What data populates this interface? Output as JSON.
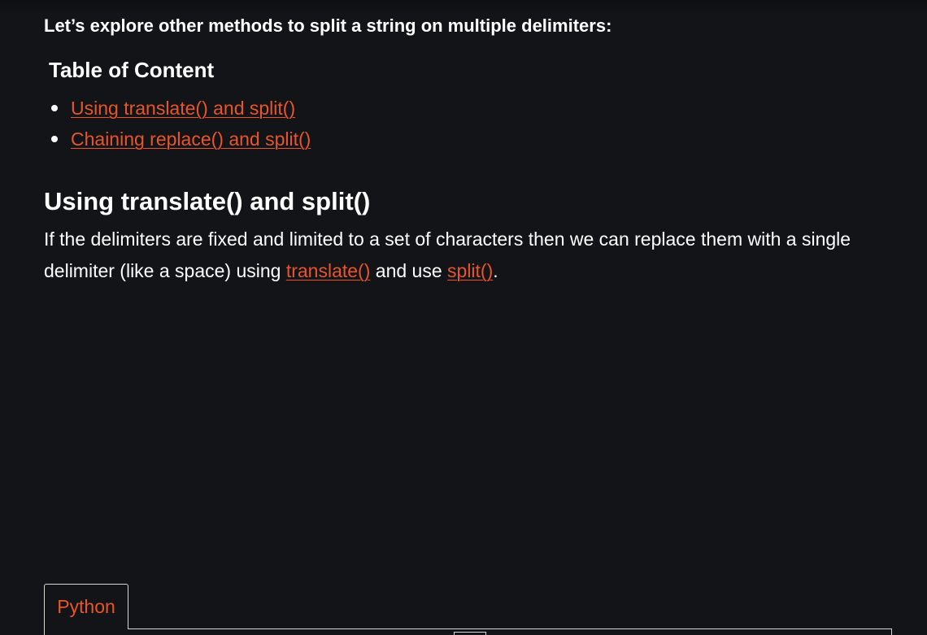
{
  "intro": "Let’s explore other methods to split a string on multiple delimiters:",
  "toc": {
    "title": "Table of Content",
    "items": [
      {
        "label": "Using translate() and split()"
      },
      {
        "label": "Chaining replace() and split()"
      }
    ]
  },
  "section": {
    "heading": "Using translate() and split()",
    "text_before": "If the delimiters are fixed and limited to a set of characters then we can replace them with a single delimiter (like a space) using ",
    "link1": "translate()",
    "text_middle": " and use ",
    "link2": "split()",
    "text_after": "."
  },
  "code_tabs": [
    {
      "label": "Python"
    }
  ],
  "colors": {
    "background": "#131417",
    "text": "#ffffff",
    "link": "#e8552a",
    "border": "#d7d7d7"
  }
}
